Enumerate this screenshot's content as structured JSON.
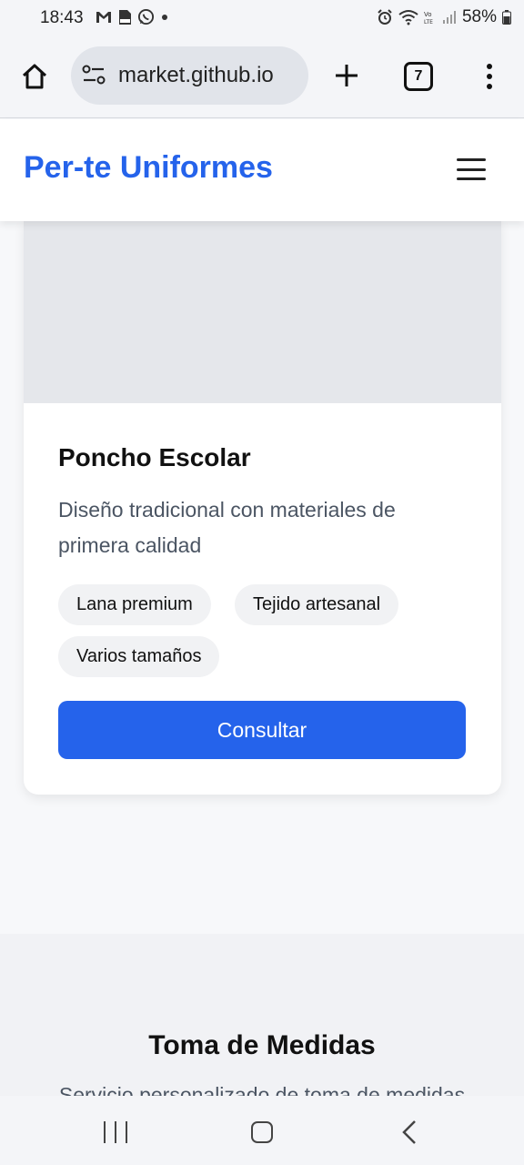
{
  "status_bar": {
    "time": "18:43",
    "battery": "58%",
    "icons_left": [
      "gmail-icon",
      "pdf-icon",
      "whatsapp-icon",
      "dot-icon"
    ],
    "icons_right": [
      "alarm-icon",
      "wifi-icon",
      "volte-icon",
      "signal-icon",
      "battery-icon"
    ]
  },
  "browser": {
    "url": "market.github.io",
    "tab_count": "7"
  },
  "site": {
    "brand": "Per-te Uniformes",
    "accent_color": "#2563eb"
  },
  "product": {
    "title": "Poncho Escolar",
    "description": "Diseño tradicional con materiales de primera calidad",
    "tags": [
      "Lana premium",
      "Tejido artesanal",
      "Varios tamaños"
    ],
    "button_label": "Consultar"
  },
  "section": {
    "title": "Toma de Medidas",
    "subtitle": "Servicio personalizado de toma de medidas"
  }
}
